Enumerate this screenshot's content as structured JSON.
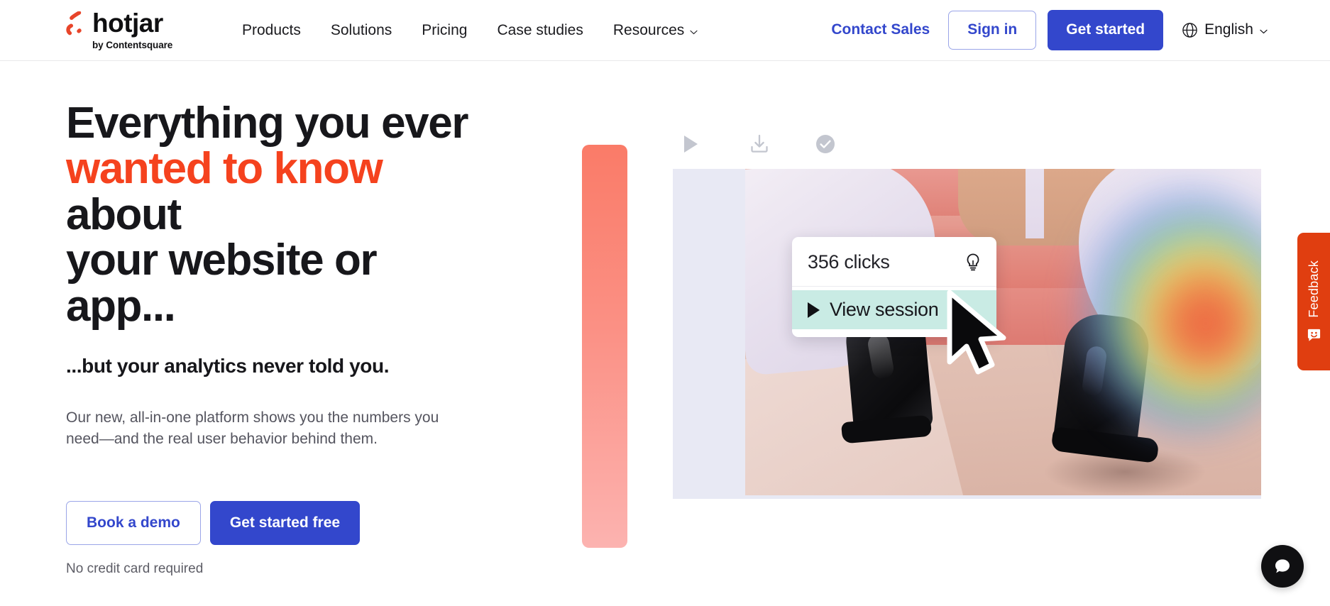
{
  "brand": {
    "name": "hotjar",
    "tagline": "by Contentsquare",
    "accent_orange": "#f5421e",
    "accent_blue": "#3347cc",
    "logo_icon": "hotjar-flame-icon"
  },
  "nav": {
    "items": [
      {
        "label": "Products",
        "has_caret": false
      },
      {
        "label": "Solutions",
        "has_caret": false
      },
      {
        "label": "Pricing",
        "has_caret": false
      },
      {
        "label": "Case studies",
        "has_caret": false
      },
      {
        "label": "Resources",
        "has_caret": true
      }
    ],
    "contact_sales": "Contact Sales",
    "sign_in": "Sign in",
    "get_started": "Get started",
    "language": "English",
    "language_icon": "globe-icon",
    "caret_icon": "chevron-down-icon"
  },
  "hero": {
    "headline_line1": "Everything you ever",
    "headline_accent": "wanted to know",
    "headline_line2_rest": " about",
    "headline_line3": "your website or app...",
    "subhead": "...but your analytics never told you.",
    "lede": "Our new, all-in-one platform shows you the numbers you need—and the real user behavior behind them.",
    "cta_primary": "Get started free",
    "cta_secondary": "Book a demo",
    "note": "No credit card required"
  },
  "media": {
    "toolbar": [
      {
        "name": "play-icon",
        "label": "Play"
      },
      {
        "name": "download-icon",
        "label": "Download"
      },
      {
        "name": "check-circle-icon",
        "label": "Done"
      }
    ],
    "overlay": {
      "clicks": "356 clicks",
      "clicks_icon": "lightbulb-icon",
      "session_label": "View session",
      "session_icon": "play-triangle-icon",
      "session_highlight": "#c9ebe4"
    },
    "cursor_icon": "mouse-pointer-icon"
  },
  "feedback": {
    "label": "Feedback",
    "icon": "smiley-speech-bubble-icon",
    "color": "#e03e10"
  },
  "chat": {
    "icon": "chat-bubble-icon",
    "color": "#101012"
  }
}
